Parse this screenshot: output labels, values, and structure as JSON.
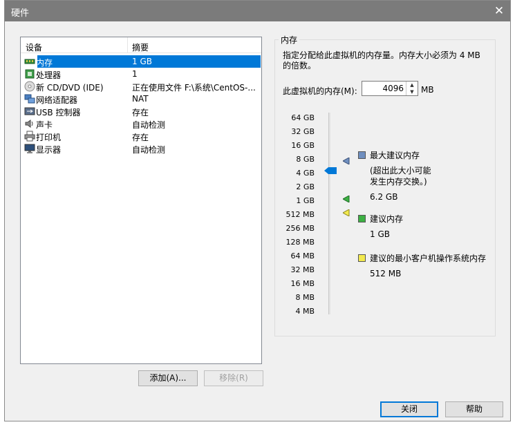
{
  "window": {
    "title": "硬件",
    "close_glyph": "✕"
  },
  "devices": {
    "headers": {
      "device": "设备",
      "summary": "摘要"
    },
    "rows": [
      {
        "name": "内存",
        "summary": "1 GB",
        "icon": "memory-icon",
        "selected": true
      },
      {
        "name": "处理器",
        "summary": "1",
        "icon": "processor-icon"
      },
      {
        "name": "新 CD/DVD (IDE)",
        "summary": "正在使用文件 F:\\系统\\CentOS-...",
        "icon": "cd-dvd-icon"
      },
      {
        "name": "网络适配器",
        "summary": "NAT",
        "icon": "network-adapter-icon"
      },
      {
        "name": "USB 控制器",
        "summary": "存在",
        "icon": "usb-icon"
      },
      {
        "name": "声卡",
        "summary": "自动检测",
        "icon": "sound-card-icon"
      },
      {
        "name": "打印机",
        "summary": "存在",
        "icon": "printer-icon"
      },
      {
        "name": "显示器",
        "summary": "自动检测",
        "icon": "display-icon"
      }
    ],
    "add_button": "添加(A)...",
    "remove_button": "移除(R)"
  },
  "memory": {
    "group_title": "内存",
    "description": "指定分配给此虚拟机的内存量。内存大小必须为 4 MB 的倍数。",
    "field_label": "此虚拟机的内存(M):",
    "value": "4096",
    "unit": "MB",
    "scale": [
      "64 GB",
      "32 GB",
      "16 GB",
      "8 GB",
      "4 GB",
      "2 GB",
      "1 GB",
      "512 MB",
      "256 MB",
      "128 MB",
      "64 MB",
      "32 MB",
      "16 MB",
      "8 MB",
      "4 MB"
    ],
    "current_level": "4 GB",
    "legend": {
      "max": {
        "title": "最大建议内存",
        "note_line1": "(超出此大小可能",
        "note_line2": "发生内存交换。)",
        "value": "6.2 GB",
        "color": "#6f8fbf"
      },
      "recommended": {
        "title": "建议内存",
        "value": "1 GB",
        "color": "#3cb043"
      },
      "minimum": {
        "title": "建议的最小客户机操作系统内存",
        "value": "512 MB",
        "color": "#f2e94e"
      }
    }
  },
  "footer": {
    "close_button": "关闭",
    "help_button": "帮助"
  }
}
